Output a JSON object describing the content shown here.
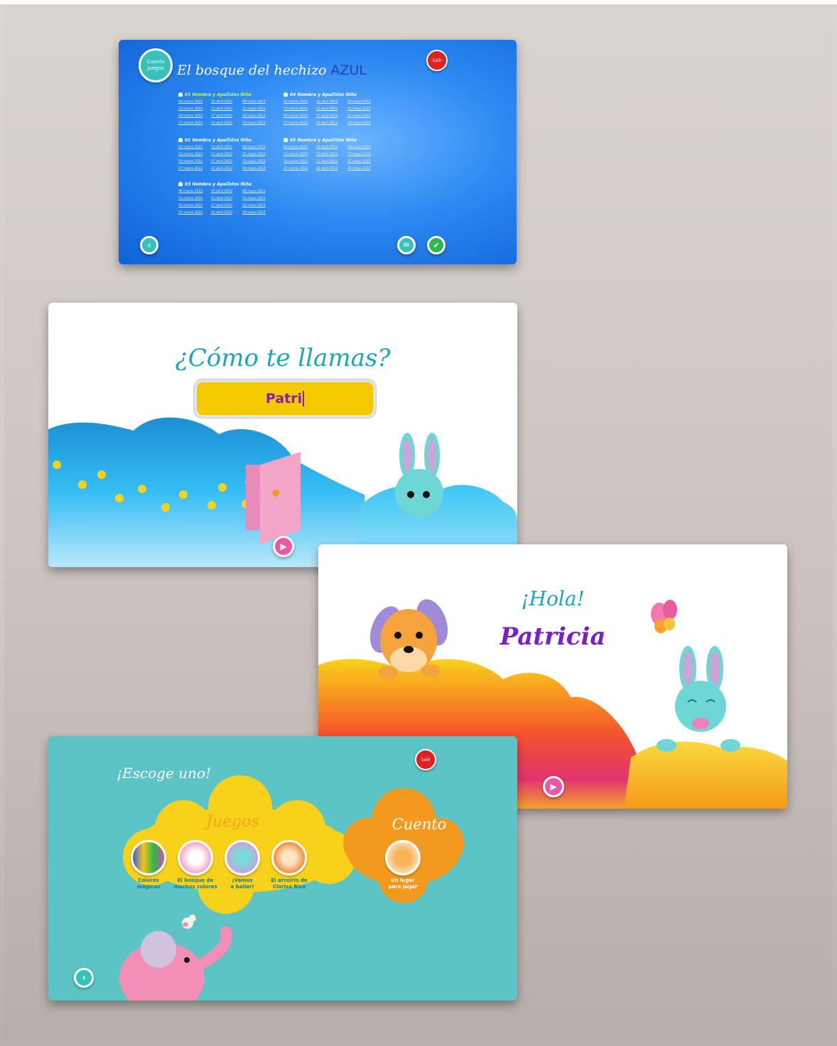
{
  "screen1": {
    "logo": "Cuento Juegos",
    "title": "El bosque del hechizo",
    "title_accent": "AZUL",
    "salir": "Salir",
    "children": [
      {
        "name": "01 Nombre y Apellidos Niño",
        "highlight": true,
        "dates": [
          "06 marzo 2023",
          "10 abril 2023",
          "08 mayo 2023",
          "13 marzo 2023",
          "13 abril 2023",
          "15 mayo 2023",
          "20 marzo 2023",
          "17 abril 2023",
          "22 mayo 2023",
          "27 marzo 2023",
          "24 abril 2023",
          "29 mayo 2023"
        ]
      },
      {
        "name": "04 Nombre y Apellidos Niño",
        "highlight": false,
        "dates": [
          "06 marzo 2023",
          "10 abril 2023",
          "08 mayo 2023",
          "13 marzo 2023",
          "13 abril 2023",
          "15 mayo 2023",
          "20 marzo 2023",
          "17 abril 2023",
          "22 mayo 2023",
          "27 marzo 2023",
          "24 abril 2023",
          "29 mayo 2023"
        ]
      },
      {
        "name": "02 Nombre y Apellidos Niño",
        "highlight": false,
        "dates": [
          "06 marzo 2023",
          "10 abril 2023",
          "08 mayo 2023",
          "13 marzo 2023",
          "13 abril 2023",
          "15 mayo 2023",
          "20 marzo 2023",
          "17 abril 2023",
          "22 mayo 2023",
          "27 marzo 2023",
          "24 abril 2023",
          "29 mayo 2023"
        ]
      },
      {
        "name": "05 Nombre y Apellidos Niño",
        "highlight": false,
        "dates": [
          "06 marzo 2023",
          "10 abril 2023",
          "08 mayo 2023",
          "13 marzo 2023",
          "13 abril 2023",
          "15 mayo 2023",
          "20 marzo 2023",
          "17 abril 2023",
          "22 mayo 2023",
          "27 marzo 2023",
          "24 abril 2023",
          "29 mayo 2023"
        ]
      },
      {
        "name": "03 Nombre y Apellidos Niño",
        "highlight": false,
        "dates": [
          "06 marzo 2023",
          "10 abril 2023",
          "08 mayo 2023",
          "13 marzo 2023",
          "13 abril 2023",
          "15 mayo 2023",
          "20 marzo 2023",
          "17 abril 2023",
          "22 mayo 2023",
          "27 marzo 2023",
          "24 abril 2023",
          "29 mayo 2023"
        ]
      }
    ],
    "colors": {
      "background": "#1f77e8",
      "back_button": "#37c2b9",
      "confirm_button": "#2fb84a",
      "mail_button": "#37c2b9",
      "salir_button": "#e02121"
    }
  },
  "screen2": {
    "question": "¿Cómo te llamas?",
    "name_input_value": "Patri",
    "colors": {
      "input_bg": "#f5c800",
      "input_text": "#8a1ab0",
      "title": "#1aa6b7",
      "cloud": "#29b6f0",
      "play": "#e85aa5"
    }
  },
  "screen3": {
    "greeting": "¡Hola!",
    "name": "Patricia",
    "colors": {
      "greeting": "#1aa6b7",
      "name": "#7a1fc4"
    }
  },
  "screen4": {
    "title": "¡Escoge uno!",
    "salir": "Salir",
    "juegos_label": "Juegos",
    "games": [
      {
        "label_line1": "Colores",
        "label_line2": "mágicos",
        "icon": "crayons-icon"
      },
      {
        "label_line1": "El bosque de",
        "label_line2": "muchos colores",
        "icon": "unicorn-icon"
      },
      {
        "label_line1": "¡Vamos",
        "label_line2": "a bailar!",
        "icon": "dancing-bunny-icon"
      },
      {
        "label_line1": "El arcoíris de",
        "label_line2": "Clarisa Risa",
        "icon": "girl-icon"
      }
    ],
    "cuento_label": "Cuento",
    "cuento_item": {
      "label_line1": "Un lugar",
      "label_line2": "para jugar",
      "icon": "puppy-icon"
    },
    "colors": {
      "background": "#5cc4c5",
      "juegos_cloud": "#f8d21a",
      "cuento_cloud": "#f39a1e",
      "elephant": "#f38fb6"
    }
  }
}
